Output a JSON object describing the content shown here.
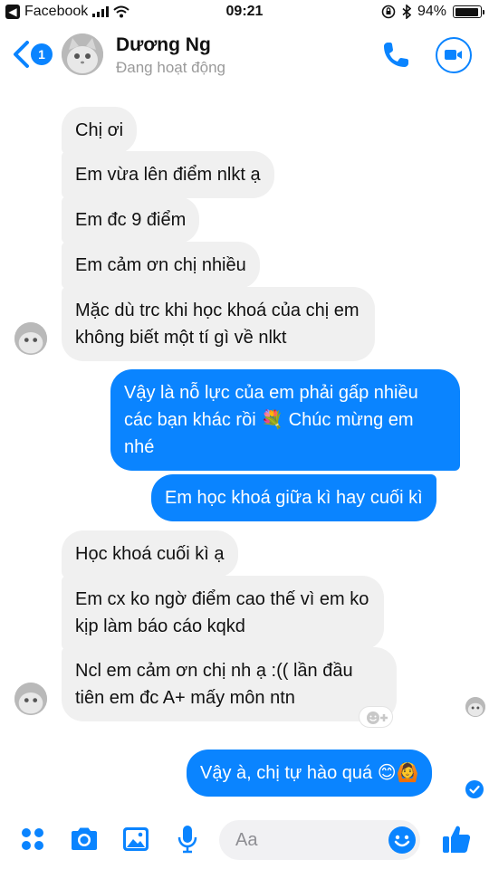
{
  "status_bar": {
    "back_app": "Facebook",
    "time": "09:21",
    "battery": "94%",
    "battery_level": 0.94
  },
  "header": {
    "back_badge": "1",
    "name": "Dương Ng",
    "status": "Đang hoạt động"
  },
  "messages": [
    {
      "side": "in",
      "text": "Chị ơi"
    },
    {
      "side": "in",
      "text": "Em vừa lên điểm nlkt ạ"
    },
    {
      "side": "in",
      "text": "Em đc 9 điểm"
    },
    {
      "side": "in",
      "text": "Em cảm ơn chị nhiều"
    },
    {
      "side": "in",
      "text": "Mặc dù trc khi học khoá của chị em không biết một tí gì về nlkt"
    },
    {
      "side": "out",
      "text": "Vậy là nỗ lực của em phải gấp nhiều các bạn khác rồi 💐 Chúc mừng em nhé"
    },
    {
      "side": "out",
      "text": "Em học khoá giữa kì hay cuối kì"
    },
    {
      "side": "in",
      "text": "Học khoá cuối kì ạ"
    },
    {
      "side": "in",
      "text": "Em cx ko ngờ điểm cao thế vì em ko kịp làm báo cáo kqkd"
    },
    {
      "side": "in",
      "text": "Ncl em cảm ơn chị nh ạ :(( lần đầu tiên em đc A+ mấy môn ntn"
    },
    {
      "side": "out",
      "text": "Vậy à, chị tự hào quá 😊🙆"
    }
  ],
  "composer": {
    "placeholder": "Aa"
  },
  "icons": [
    "facebook-back-icon",
    "signal-icon",
    "wifi-icon",
    "rotation-lock-icon",
    "bluetooth-icon",
    "battery-icon",
    "back-chevron-icon",
    "phone-icon",
    "video-camera-icon",
    "apps-grid-icon",
    "camera-icon",
    "image-icon",
    "microphone-icon",
    "emoji-icon",
    "thumbs-up-icon",
    "add-reaction-icon",
    "delivered-check-icon"
  ],
  "colors": {
    "accent": "#0a84ff",
    "incoming_bubble": "#f0f0f0",
    "outgoing_text": "#ffffff"
  }
}
